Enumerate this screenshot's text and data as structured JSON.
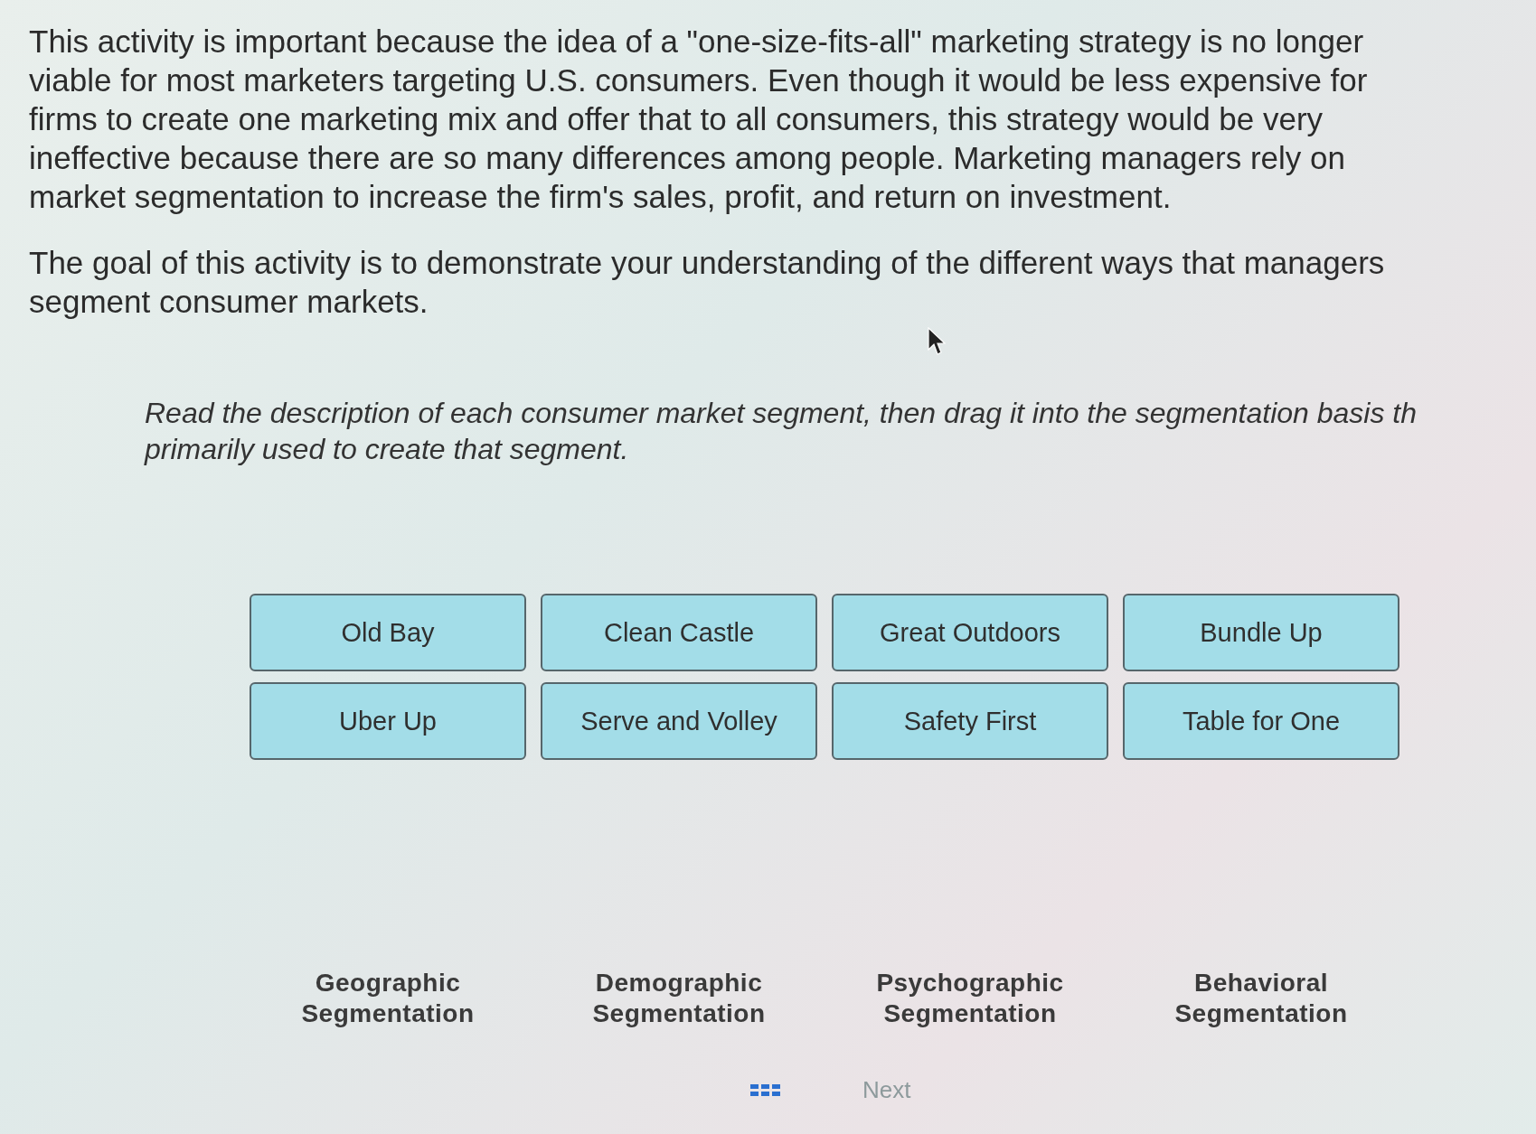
{
  "intro_paragraphs": [
    "This activity is important because the idea of a \"one-size-fits-all\" marketing strategy is no longer\nviable for most marketers targeting U.S. consumers. Even though it would be less expensive for\nfirms to create one marketing mix and offer that to all consumers, this strategy would be very\nineffective because there are so many differences among people. Marketing managers rely on\nmarket segmentation to increase the firm's sales, profit, and return on investment.",
    "The goal of this activity is to demonstrate your understanding of the different ways that managers\nsegment consumer markets."
  ],
  "instructions": "Read the description of each consumer market segment, then drag it into the segmentation basis th\nprimarily used to create that segment.",
  "segment_cards": [
    {
      "label": "Old Bay"
    },
    {
      "label": "Clean Castle"
    },
    {
      "label": "Great Outdoors"
    },
    {
      "label": "Bundle Up"
    },
    {
      "label": "Uber Up"
    },
    {
      "label": "Serve and Volley"
    },
    {
      "label": "Safety First"
    },
    {
      "label": "Table for One"
    }
  ],
  "drop_targets": [
    {
      "label": "Geographic Segmentation"
    },
    {
      "label": "Demographic Segmentation"
    },
    {
      "label": "Psychographic Segmentation"
    },
    {
      "label": "Behavioral Segmentation"
    }
  ],
  "footer": {
    "next_label": "Next"
  }
}
